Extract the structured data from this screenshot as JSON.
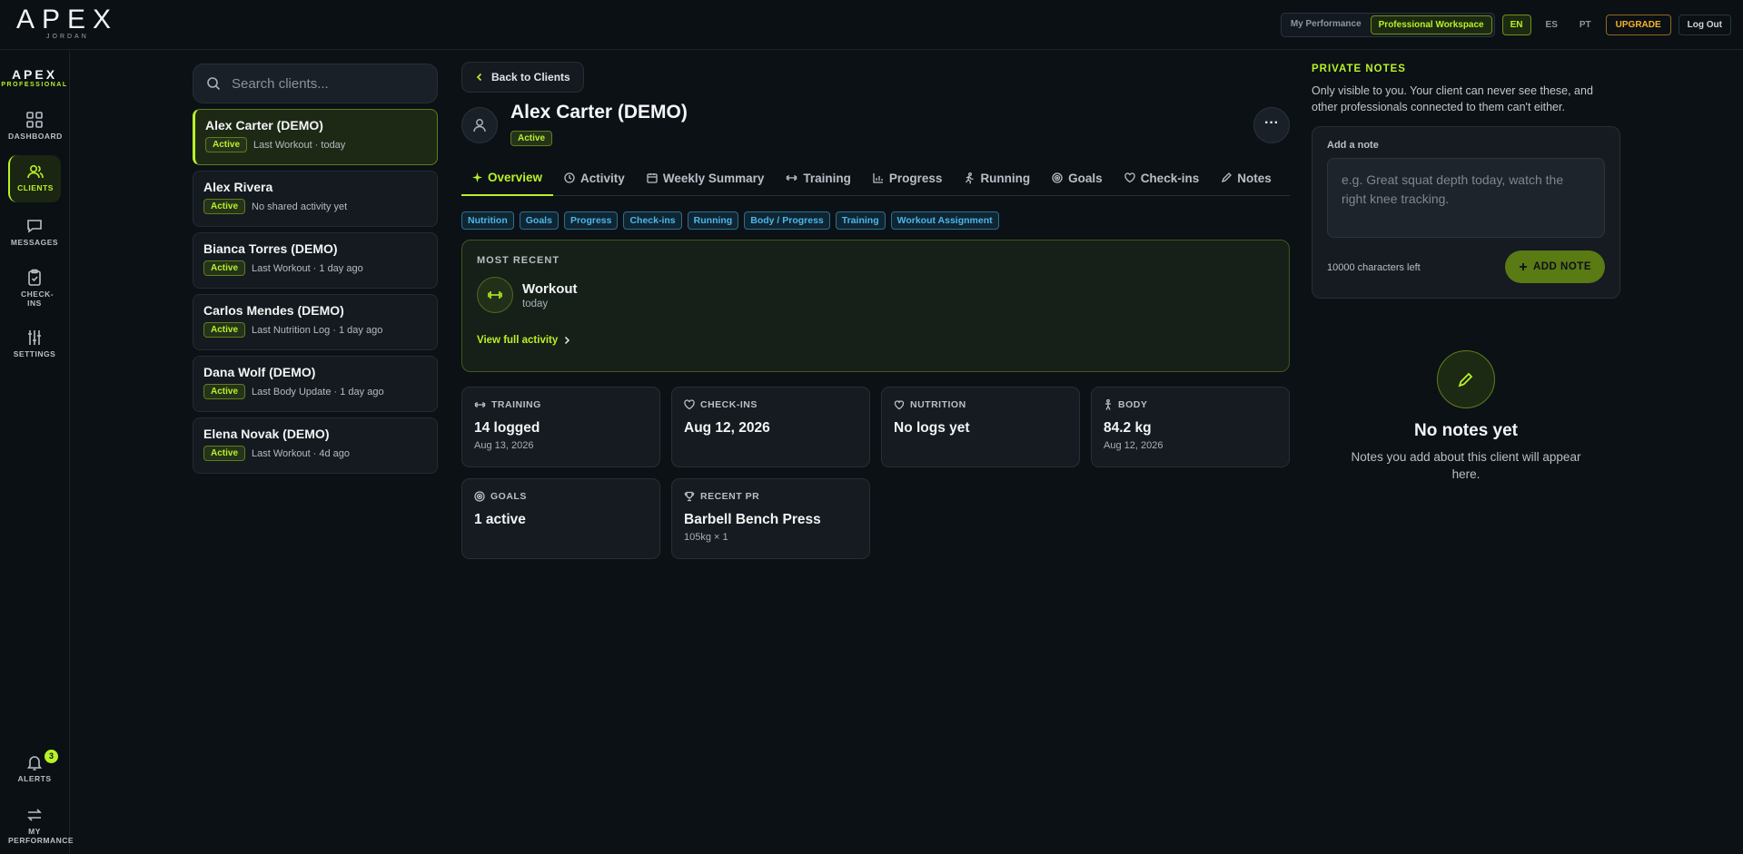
{
  "brand": {
    "logo": "APEX",
    "sub": "JORDAN"
  },
  "topnav": {
    "my_performance": "My Performance",
    "professional_workspace": "Professional Workspace",
    "langs": [
      "EN",
      "ES",
      "PT"
    ],
    "upgrade": "UPGRADE",
    "logout": "Log Out"
  },
  "rail": {
    "brand_top": "APEX",
    "brand_sub": "PROFESSIONAL",
    "items": [
      {
        "label": "DASHBOARD",
        "icon": "grid-icon"
      },
      {
        "label": "CLIENTS",
        "icon": "users-icon"
      },
      {
        "label": "MESSAGES",
        "icon": "message-icon"
      },
      {
        "label": "CHECK-INS",
        "icon": "clipboard-icon"
      },
      {
        "label": "SETTINGS",
        "icon": "sliders-icon"
      }
    ],
    "alerts_label": "ALERTS",
    "alerts_count": "3",
    "my_performance_label": "MY PERFORMANCE"
  },
  "search": {
    "placeholder": "Search clients..."
  },
  "clients": [
    {
      "name": "Alex Carter (DEMO)",
      "status": "Active",
      "last": "Last Workout · today"
    },
    {
      "name": "Alex Rivera",
      "status": "Active",
      "last": "No shared activity yet"
    },
    {
      "name": "Bianca Torres (DEMO)",
      "status": "Active",
      "last": "Last Workout · 1 day ago"
    },
    {
      "name": "Carlos Mendes (DEMO)",
      "status": "Active",
      "last": "Last Nutrition Log · 1 day ago"
    },
    {
      "name": "Dana Wolf (DEMO)",
      "status": "Active",
      "last": "Last Body Update · 1 day ago"
    },
    {
      "name": "Elena Novak (DEMO)",
      "status": "Active",
      "last": "Last Workout · 4d ago"
    }
  ],
  "main": {
    "back": "Back to Clients",
    "client_name": "Alex Carter (DEMO)",
    "status": "Active",
    "more": "···",
    "tabs": [
      "Overview",
      "Activity",
      "Weekly Summary",
      "Training",
      "Progress",
      "Running",
      "Goals",
      "Check-ins",
      "Notes"
    ],
    "chips": [
      "Nutrition",
      "Goals",
      "Progress",
      "Check-ins",
      "Running",
      "Body / Progress",
      "Training",
      "Workout Assignment"
    ],
    "recent": {
      "heading": "MOST RECENT",
      "title": "Workout",
      "when": "today",
      "link": "View full activity"
    },
    "cards": [
      {
        "title": "TRAINING",
        "value": "14 logged",
        "sub": "Aug 13, 2026"
      },
      {
        "title": "CHECK-INS",
        "value": "Aug 12, 2026",
        "sub": ""
      },
      {
        "title": "NUTRITION",
        "value": "No logs yet",
        "sub": ""
      },
      {
        "title": "BODY",
        "value": "84.2 kg",
        "sub": "Aug 12, 2026"
      },
      {
        "title": "GOALS",
        "value": "1 active",
        "sub": ""
      },
      {
        "title": "RECENT PR",
        "value": "Barbell Bench Press",
        "sub": "105kg × 1"
      }
    ]
  },
  "notes": {
    "heading": "PRIVATE NOTES",
    "desc": "Only visible to you. Your client can never see these, and other professionals connected to them can't either.",
    "add_label": "Add a note",
    "placeholder": "e.g. Great squat depth today, watch the right knee tracking.",
    "chars_left": "10000 characters left",
    "add_button": "ADD NOTE",
    "empty_title": "No notes yet",
    "empty_sub": "Notes you add about this client will appear here."
  },
  "colors": {
    "accent": "#b9f227",
    "chip": "#4ab7ea",
    "upgrade": "#f5b32a",
    "bg": "#0c1116"
  }
}
